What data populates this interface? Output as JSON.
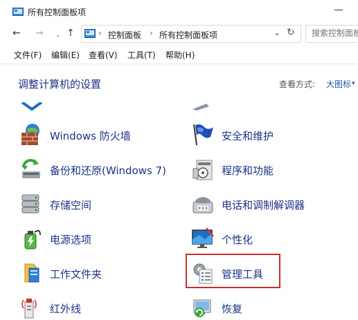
{
  "window": {
    "title": "所有控制面板项"
  },
  "nav": {
    "back": "←",
    "forward": "→",
    "recent": "⌄",
    "up": "↑",
    "breadcrumbs": [
      "控制面板",
      "所有控制面板项"
    ],
    "separator": "›",
    "dropdown": "⌄",
    "refresh": "↻",
    "search_placeholder": "搜索控制面板"
  },
  "menu": [
    "文件(F)",
    "编辑(E)",
    "查看(V)",
    "工具(T)",
    "帮助(H)"
  ],
  "main": {
    "title": "调整计算机的设置",
    "view_by_label": "查看方式:",
    "view_by_value": "大图标",
    "view_by_arrow": "▾"
  },
  "items": [
    {
      "label": "Windows 防火墙",
      "icon": "firewall-icon"
    },
    {
      "label": "安全和维护",
      "icon": "security-flag-icon"
    },
    {
      "label": "备份和还原(Windows 7)",
      "icon": "backup-restore-icon"
    },
    {
      "label": "程序和功能",
      "icon": "programs-features-icon"
    },
    {
      "label": "存储空间",
      "icon": "storage-spaces-icon"
    },
    {
      "label": "电话和调制解调器",
      "icon": "phone-modem-icon"
    },
    {
      "label": "电源选项",
      "icon": "power-options-icon"
    },
    {
      "label": "个性化",
      "icon": "personalization-icon"
    },
    {
      "label": "工作文件夹",
      "icon": "work-folders-icon"
    },
    {
      "label": "管理工具",
      "icon": "admin-tools-icon"
    },
    {
      "label": "红外线",
      "icon": "infrared-icon"
    },
    {
      "label": "恢复",
      "icon": "recovery-icon"
    }
  ],
  "colors": {
    "link_text": "#1e3287",
    "highlight_border": "#cc2b2b",
    "view_value": "#1e5aa8"
  }
}
